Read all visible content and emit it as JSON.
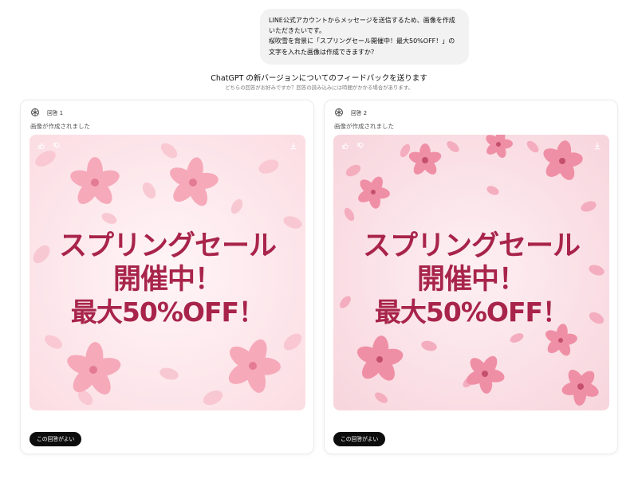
{
  "conversation": {
    "user_message": "LINE公式アカウントからメッセージを送信するため、画像を作成いただきたいです。\n桜吹雪を背景に「スプリングセール開催中！最大50%OFF！」の文字を入れた画像は作成できますか？"
  },
  "feedback": {
    "title": "ChatGPT の新バージョンについてのフィードバックを送ります",
    "subtitle": "どちらの回答がお好みですか？回答の読み込みには時間がかかる場合があります。"
  },
  "responses": [
    {
      "label": "回答 1",
      "status": "画像が作成されました",
      "image_text": [
        "スプリングセール",
        "開催中！",
        "最大50%OFF！"
      ],
      "prefer_label": "この回答がよい"
    },
    {
      "label": "回答 2",
      "status": "画像が作成されました",
      "image_text": [
        "スプリングセール",
        "開催中！",
        "最大50%OFF！"
      ],
      "prefer_label": "この回答がよい"
    }
  ],
  "icons": {
    "assistant": "chatgpt-logo-icon",
    "like": "thumbs-up-icon",
    "dislike": "thumbs-down-icon",
    "download": "download-icon"
  },
  "colors": {
    "promo_text": "#a8244a",
    "background_pink": "#fbe6ea",
    "petal_pink": "#f7b9c6",
    "button_bg": "#0d0d0d"
  }
}
